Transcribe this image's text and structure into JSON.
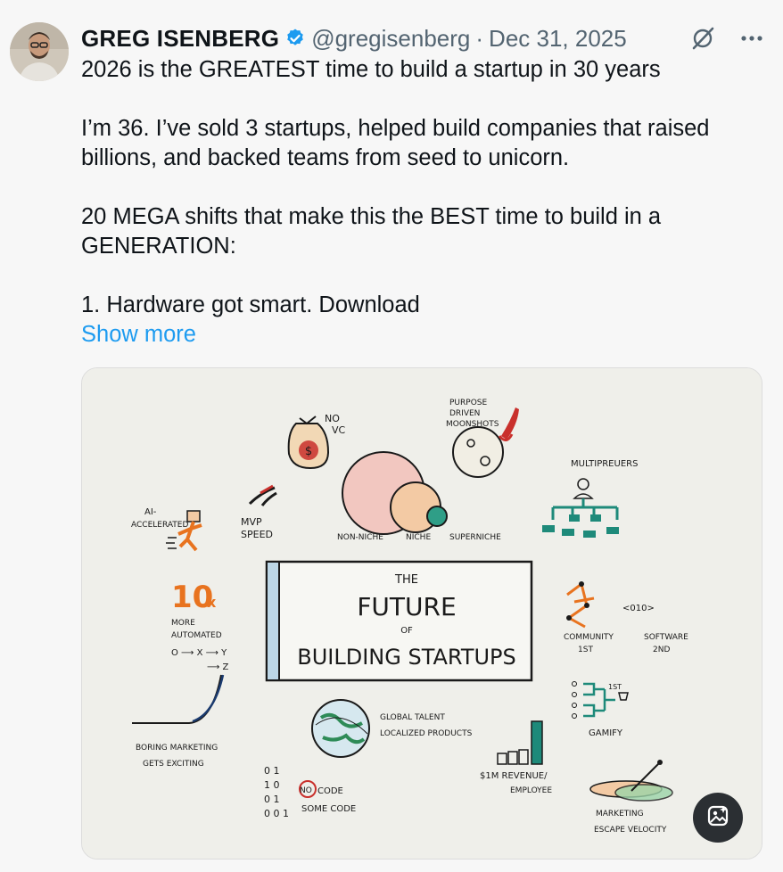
{
  "author": {
    "name": "GREG ISENBERG",
    "handle": "@gregisenberg",
    "separator": "·",
    "date": "Dec 31, 2025"
  },
  "header_icons": [
    "grok-slash-icon",
    "more-dots-icon"
  ],
  "tweet": {
    "line1": "2026 is the GREATEST time to build a startup in 30 years",
    "para2": "I’m 36. I’ve sold 3 startups, helped build companies that raised billions, and backed teams from seed to unicorn.",
    "para3": "20 MEGA shifts that make this the BEST time to build in a GENERATION:",
    "para4": "1. Hardware got smart. Download",
    "show_more": "Show more"
  },
  "image": {
    "title_the": "THE",
    "title_future": "FUTURE",
    "title_of": "OF",
    "title_building": "BUILDING STARTUPS",
    "no_vc_1": "NO",
    "no_vc_2": "VC",
    "purpose_1": "PURPOSE",
    "purpose_2": "DRIVEN",
    "purpose_3": "MOONSHOTS",
    "multipreneurs": "MULTIPREUERS",
    "ai_1": "AI-",
    "ai_2": "ACCELERATED",
    "mvp_1": "MVP",
    "mvp_2": "SPEED",
    "non_niche": "NON-NICHE",
    "niche": "NICHE",
    "superniche": "SUPERNICHE",
    "ten_x": "10",
    "ten_x_suffix": "x",
    "more_automated_1": "MORE",
    "more_automated_2": "AUTOMATED",
    "flow_1": "O ⟶ X ⟶ Y",
    "flow_2": "⟶ Z",
    "community_code": "<010>",
    "community": "COMMUNITY",
    "community_sub": "1ST",
    "software": "SOFTWARE",
    "software_sub": "2ND",
    "first_place": "1ST",
    "gamify": "GAMIFY",
    "global_1": "GLOBAL TALENT",
    "global_2": "LOCALIZED PRODUCTS",
    "boring_1": "BORING MARKETING",
    "boring_2": "GETS EXCITING",
    "revenue_1": "$1M REVENUE/",
    "revenue_2": "EMPLOYEE",
    "no_code": "NO",
    "code_1": "CODE",
    "code_2": "SOME CODE",
    "binary_1": "0 1",
    "binary_2": "1 0",
    "binary_3": "0 1",
    "binary_4": "0 0 1",
    "marketing_1": "MARKETING",
    "marketing_2": "ESCAPE VELOCITY"
  },
  "colors": {
    "link": "#1d9bf0",
    "verified": "#1d9bf0",
    "secondary_text": "#536471",
    "orange": "#e8731f",
    "teal": "#1e8a7a",
    "red": "#c9302c",
    "green": "#2e8b57"
  }
}
